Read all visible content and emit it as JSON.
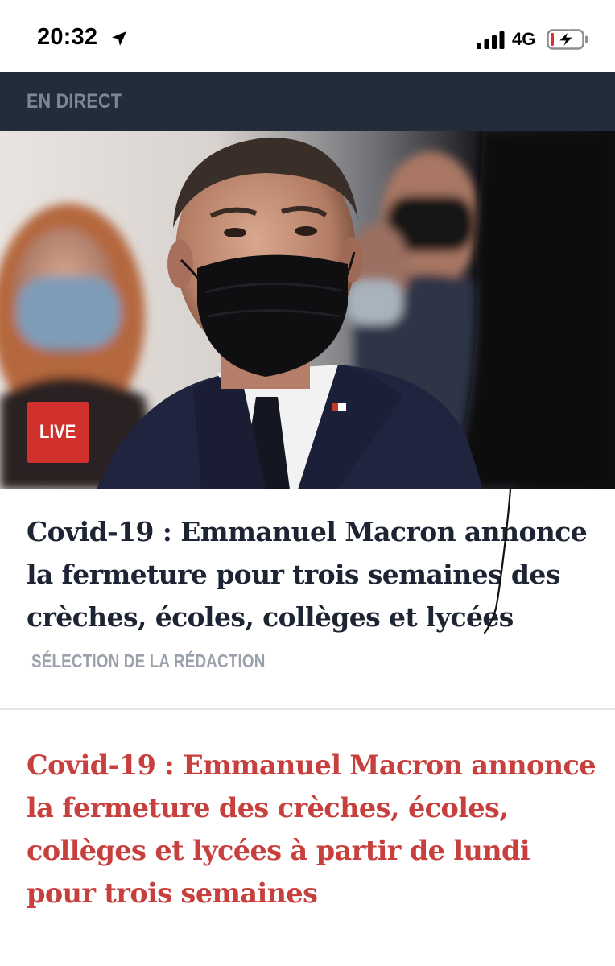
{
  "status_bar": {
    "time": "20:32",
    "network": "4G",
    "icons": [
      "location-arrow-icon",
      "signal-bars-icon",
      "battery-charging-icon"
    ]
  },
  "section": {
    "label": "EN DIRECT"
  },
  "hero": {
    "image": "photo-emmanuel-macron-masked",
    "badge": "LIVE",
    "badge_color": "#d0312d"
  },
  "story_1": {
    "headline": "Covid-19 : Emmanuel Macron annonce la fermeture pour trois semaines des crèches, écoles, collèges et lycées",
    "tag": "SÉLECTION DE LA RÉDACTION",
    "headline_color": "#1d2433",
    "tag_color": "#9aa1ab"
  },
  "story_2": {
    "headline": "Covid-19 : Emmanuel Macron annonce la fermeture des crèches, écoles, collèges et lycées à partir de lundi pour trois semaines",
    "headline_color": "#c7403d"
  },
  "colors": {
    "header_bg": "#222c3a",
    "header_text": "#7b8797"
  }
}
